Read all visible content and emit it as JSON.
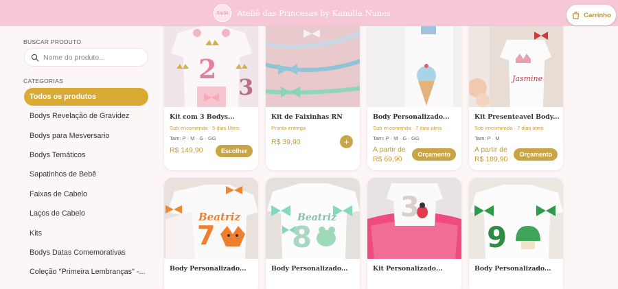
{
  "header": {
    "logo_text": "Ateliê",
    "brand_name": "Ateliê das Princesas by Kamilla Nunes",
    "cart_label": "Carrinho"
  },
  "sidebar": {
    "search_title": "BUSCAR PRODUTO",
    "search_placeholder": "Nome do produto...",
    "categories_title": "CATEGORIAS",
    "categories": [
      {
        "label": "Todos os produtos"
      },
      {
        "label": "Bodys Revelação de Gravidez"
      },
      {
        "label": "Bodys para Mesversario"
      },
      {
        "label": "Bodys Temáticos"
      },
      {
        "label": "Sapatinhos de Bebê"
      },
      {
        "label": "Faixas de Cabelo"
      },
      {
        "label": "Laços de Cabelo"
      },
      {
        "label": "Kits"
      },
      {
        "label": "Bodys Datas Comemorativas"
      },
      {
        "label": "Coleção \"Primeira Lembranças\" -..."
      }
    ]
  },
  "products": [
    {
      "title": "Kit com 3 Bodys...",
      "status": "Sob encomenda · 5 dias Úteis",
      "sizes": "Tam: P · M · G · GG",
      "price": "R$ 149,90",
      "action": "Escolher"
    },
    {
      "title": "Kit de Faixinhas RN",
      "status": "Pronta entrega",
      "price": "R$ 39,90",
      "action": "+"
    },
    {
      "title": "Body Personalizado...",
      "status": "Sob encomenda · 7 dias úteis",
      "sizes": "Tam: P · M · G · GG",
      "price_prefix": "A partir de",
      "price": "R$ 69,90",
      "action": "Orçamento"
    },
    {
      "title": "Kit Presenteavel Body...",
      "status": "Sob encomenda · 7 dias úteis",
      "sizes": "Tam: P · M",
      "price_prefix": "A partir de",
      "price": "R$ 189,90",
      "action": "Orçamento"
    },
    {
      "title": "Body Personalizado..."
    },
    {
      "title": "Body Personalizado..."
    },
    {
      "title": "Kit Personalizado..."
    },
    {
      "title": "Body Personalizado..."
    }
  ],
  "image_text": {
    "p5_name": "Beatriz",
    "p5_num": "7",
    "p6_name": "Beatriz",
    "p6_num": "8",
    "p7_num": "3",
    "p8_num": "9",
    "p4_name": "Jasmine",
    "p1_num_a": "2",
    "p1_num_b": "3"
  },
  "colors": {
    "header_bg": "#f6c7d7",
    "accent": "#d9ab34",
    "price": "#c09a3c",
    "page_bg": "#fdf6f6"
  },
  "icons": [
    "logo-icon",
    "cart-icon",
    "search-icon"
  ]
}
